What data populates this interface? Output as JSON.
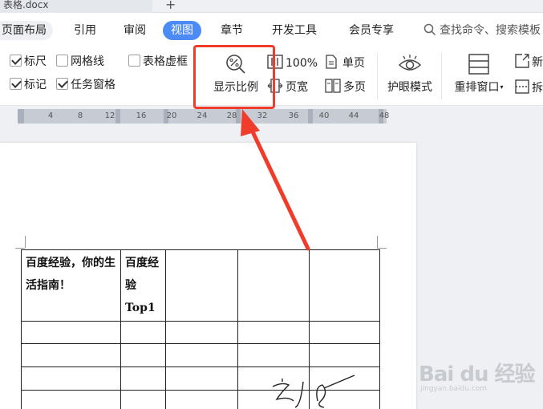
{
  "window": {
    "tab_title": "表格.docx"
  },
  "menu": {
    "items": [
      {
        "label": "页面布局"
      },
      {
        "label": "引用"
      },
      {
        "label": "审阅"
      },
      {
        "label": "视图",
        "active": true
      },
      {
        "label": "章节"
      },
      {
        "label": "开发工具"
      },
      {
        "label": "会员专享"
      }
    ],
    "search_placeholder": "查找命令、搜索模板"
  },
  "ribbon": {
    "checkboxes": [
      {
        "label": "标尺",
        "checked": true
      },
      {
        "label": "网格线",
        "checked": false
      },
      {
        "label": "表格虚框",
        "checked": false
      },
      {
        "label": "标记",
        "checked": true
      },
      {
        "label": "任务窗格",
        "checked": true
      }
    ],
    "zoom_label": "显示比例",
    "zoom100_label": "100%",
    "page_width_label": "页宽",
    "single_page_label": "单页",
    "multi_page_label": "多页",
    "eye_mode_label": "护眼模式",
    "rearrange_label": "重排窗口",
    "new_window_label": "新",
    "split_label": "拆"
  },
  "ruler": {
    "ticks": [
      "4",
      "8",
      "12",
      "16",
      "20",
      "24",
      "28",
      "32",
      "36",
      "40",
      "44",
      "48"
    ]
  },
  "document": {
    "rows": [
      [
        "百度经验，你的生活指南！",
        "百度经验Top1",
        "",
        "",
        ""
      ],
      [
        "",
        "",
        "",
        "",
        ""
      ],
      [
        "",
        "",
        "",
        "",
        ""
      ],
      [
        "",
        "",
        "",
        "",
        ""
      ],
      [
        "",
        "",
        "",
        "",
        ""
      ]
    ]
  },
  "watermark": {
    "brand": "Bai du 经验",
    "url": "jingyan.baidu.com"
  },
  "colors": {
    "accent": "#4c8bf5",
    "highlight": "#f03c2a"
  }
}
